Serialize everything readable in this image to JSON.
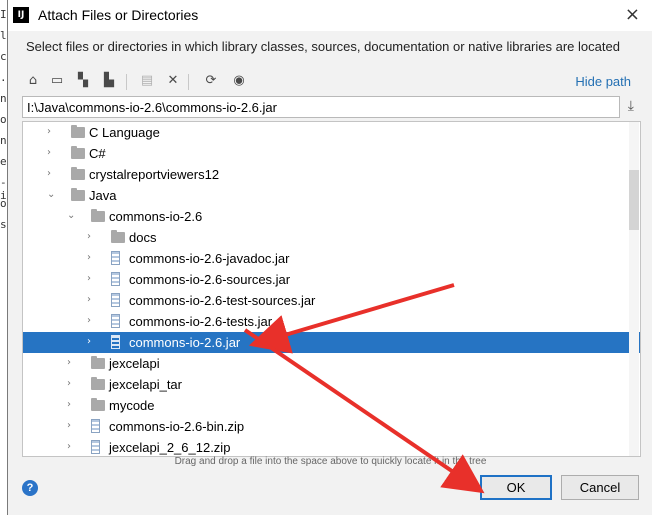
{
  "background_editor": {
    "lines": [
      {
        "text": "I"
      },
      {
        "text": "l"
      },
      {
        "text": "ce"
      },
      {
        "text": ".c"
      },
      {
        "text": "n"
      },
      {
        "text": "o"
      },
      {
        "text": "nl"
      },
      {
        "text": "e"
      },
      {
        "text": "-i"
      },
      {
        "text": "o"
      },
      {
        "text": "se"
      }
    ]
  },
  "window": {
    "title": "Attach Files or Directories",
    "app_icon": "IJ",
    "close_icon": "×"
  },
  "description": "Select files or directories in which library classes, sources, documentation or native libraries are located",
  "toolbar": {
    "icons": [
      {
        "name": "home-icon",
        "glyph": "⌂"
      },
      {
        "name": "desktop-icon",
        "glyph": "▭"
      },
      {
        "name": "project-icon",
        "glyph": "▚"
      },
      {
        "name": "module-icon",
        "glyph": "▙"
      },
      {
        "name": "new-folder-icon",
        "glyph": "▤"
      },
      {
        "name": "delete-icon",
        "glyph": "✕"
      },
      {
        "name": "refresh-icon",
        "glyph": "⟳"
      },
      {
        "name": "show-hidden-icon",
        "glyph": "◉"
      }
    ],
    "hide_path_label": "Hide path",
    "download_icon": "⤓"
  },
  "path": {
    "value": "I:\\Java\\commons-io-2.6\\commons-io-2.6.jar"
  },
  "tree": {
    "rows": [
      {
        "label": "C Language",
        "type": "folder",
        "depth": 1,
        "expanded": false,
        "has_arrow": true,
        "selected": false
      },
      {
        "label": "C#",
        "type": "folder",
        "depth": 1,
        "expanded": false,
        "has_arrow": true,
        "selected": false
      },
      {
        "label": "crystalreportviewers12",
        "type": "folder",
        "depth": 1,
        "expanded": false,
        "has_arrow": true,
        "selected": false
      },
      {
        "label": "Java",
        "type": "folder",
        "depth": 1,
        "expanded": true,
        "has_arrow": true,
        "selected": false
      },
      {
        "label": "commons-io-2.6",
        "type": "folder",
        "depth": 2,
        "expanded": true,
        "has_arrow": true,
        "selected": false
      },
      {
        "label": "docs",
        "type": "folder",
        "depth": 3,
        "expanded": false,
        "has_arrow": true,
        "selected": false
      },
      {
        "label": "commons-io-2.6-javadoc.jar",
        "type": "jar",
        "depth": 3,
        "expanded": false,
        "has_arrow": true,
        "selected": false
      },
      {
        "label": "commons-io-2.6-sources.jar",
        "type": "jar",
        "depth": 3,
        "expanded": false,
        "has_arrow": true,
        "selected": false
      },
      {
        "label": "commons-io-2.6-test-sources.jar",
        "type": "jar",
        "depth": 3,
        "expanded": false,
        "has_arrow": true,
        "selected": false
      },
      {
        "label": "commons-io-2.6-tests.jar",
        "type": "jar",
        "depth": 3,
        "expanded": false,
        "has_arrow": true,
        "selected": false
      },
      {
        "label": "commons-io-2.6.jar",
        "type": "jar",
        "depth": 3,
        "expanded": false,
        "has_arrow": true,
        "selected": true
      },
      {
        "label": "jexcelapi",
        "type": "folder",
        "depth": 2,
        "expanded": false,
        "has_arrow": true,
        "selected": false
      },
      {
        "label": "jexcelapi_tar",
        "type": "folder",
        "depth": 2,
        "expanded": false,
        "has_arrow": true,
        "selected": false
      },
      {
        "label": "mycode",
        "type": "folder",
        "depth": 2,
        "expanded": false,
        "has_arrow": true,
        "selected": false
      },
      {
        "label": "commons-io-2.6-bin.zip",
        "type": "jar",
        "depth": 2,
        "expanded": false,
        "has_arrow": true,
        "selected": false
      },
      {
        "label": "jexcelapi_2_6_12.zip",
        "type": "jar",
        "depth": 2,
        "expanded": false,
        "has_arrow": true,
        "selected": false
      }
    ]
  },
  "hint": "Drag and drop a file into the space above to quickly locate it in the tree",
  "buttons": {
    "help": "?",
    "ok": "OK",
    "cancel": "Cancel"
  },
  "colors": {
    "selection": "#2674c3",
    "link": "#2470b3",
    "annotation_arrow": "#e8302a"
  }
}
